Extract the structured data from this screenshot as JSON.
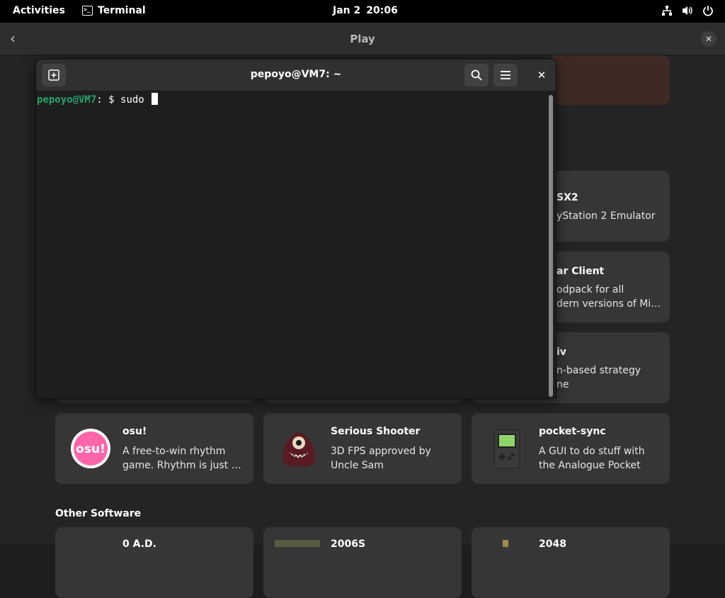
{
  "topbar": {
    "activities": "Activities",
    "app_name": "Terminal",
    "date": "Jan 2",
    "time": "20:06"
  },
  "software": {
    "title": "Play",
    "back_icon": "chevron-left-icon",
    "close_icon": "close-icon",
    "peek_cards": [
      {
        "title": "SX2",
        "line1": "yStation 2 Emulator",
        "line2": ""
      },
      {
        "title": "ar Client",
        "line1": "odpack for all",
        "line2": "dern versions of Mi…"
      },
      {
        "title": "iv",
        "line1": "n-based strategy",
        "line2": "ne"
      }
    ],
    "cards": [
      {
        "title": "osu!",
        "desc": "A free-to-win rhythm game. Rhythm is just …",
        "icon": "osu-icon"
      },
      {
        "title": "Serious Shooter",
        "desc": "3D FPS approved by Uncle Sam",
        "icon": "serious-shooter-icon"
      },
      {
        "title": "pocket-sync",
        "desc": "A GUI to do stuff with the Analogue Pocket",
        "icon": "pocket-sync-icon"
      }
    ],
    "section_other": "Other Software",
    "bottom_cards": [
      {
        "title": "0 A.D."
      },
      {
        "title": "2006S"
      },
      {
        "title": "2048"
      }
    ]
  },
  "terminal": {
    "title": "pepoyo@VM7: ~",
    "prompt_user": "pepoyo@VM7",
    "prompt_rest": ": $ sudo ",
    "icons": {
      "new_tab": "new-tab-icon",
      "search": "search-icon",
      "menu": "hamburger-menu-icon",
      "close": "close-icon"
    }
  },
  "colors": {
    "prompt_green": "#26a269",
    "terminal_bg": "#1e1e1e",
    "osu_pink": "#ff66aa"
  }
}
